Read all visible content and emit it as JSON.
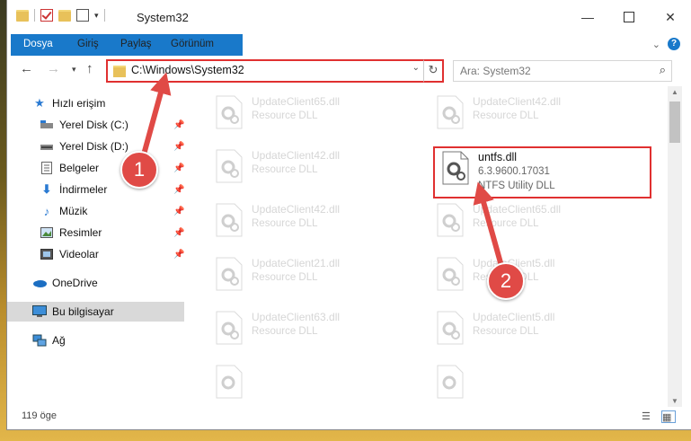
{
  "window": {
    "title": "System32"
  },
  "ribbon": {
    "tabs": [
      "Dosya",
      "Giriş",
      "Paylaş",
      "Görünüm"
    ]
  },
  "nav": {
    "address": "C:\\Windows\\System32",
    "search_placeholder": "Ara: System32"
  },
  "sidebar": {
    "items": [
      {
        "label": "Hızlı erişim",
        "icon": "star-icon"
      },
      {
        "label": "Yerel Disk (C:)",
        "icon": "drive-icon",
        "pinned": true
      },
      {
        "label": "Yerel Disk (D:)",
        "icon": "drive-icon",
        "pinned": true
      },
      {
        "label": "Belgeler",
        "icon": "documents-icon",
        "pinned": true
      },
      {
        "label": "İndirmeler",
        "icon": "download-icon",
        "pinned": true
      },
      {
        "label": "Müzik",
        "icon": "music-icon",
        "pinned": true
      },
      {
        "label": "Resimler",
        "icon": "pictures-icon",
        "pinned": true
      },
      {
        "label": "Videolar",
        "icon": "videos-icon",
        "pinned": true
      },
      {
        "label": "OneDrive",
        "icon": "cloud-icon"
      },
      {
        "label": "Bu bilgisayar",
        "icon": "computer-icon",
        "selected": true
      },
      {
        "label": "Ağ",
        "icon": "network-icon"
      }
    ]
  },
  "files": [
    {
      "name": "UpdateClient65.dll",
      "desc": "Resource DLL"
    },
    {
      "name": "UpdateClient42.dll",
      "desc": "Resource DLL"
    },
    {
      "name": "UpdateClient42.dll",
      "desc": "Resource DLL"
    },
    {
      "name": "untfs.dll",
      "version": "6.3.9600.17031",
      "desc": "NTFS Utility DLL",
      "highlighted": true
    },
    {
      "name": "UpdateClient42.dll",
      "desc": "Resource DLL"
    },
    {
      "name": "UpdateClient65.dll",
      "desc": "Resource DLL"
    },
    {
      "name": "UpdateClient21.dll",
      "desc": "Resource DLL"
    },
    {
      "name": "UpdateClient5.dll",
      "desc": "Resource DLL"
    },
    {
      "name": "UpdateClient63.dll",
      "desc": "Resource DLL"
    },
    {
      "name": "UpdateClient5.dll",
      "desc": "Resource DLL"
    }
  ],
  "status": {
    "count": "119 öge"
  },
  "callouts": [
    "1",
    "2"
  ],
  "colors": {
    "accent": "#1979ca",
    "highlight": "#e03030",
    "callout": "#e04a46"
  }
}
